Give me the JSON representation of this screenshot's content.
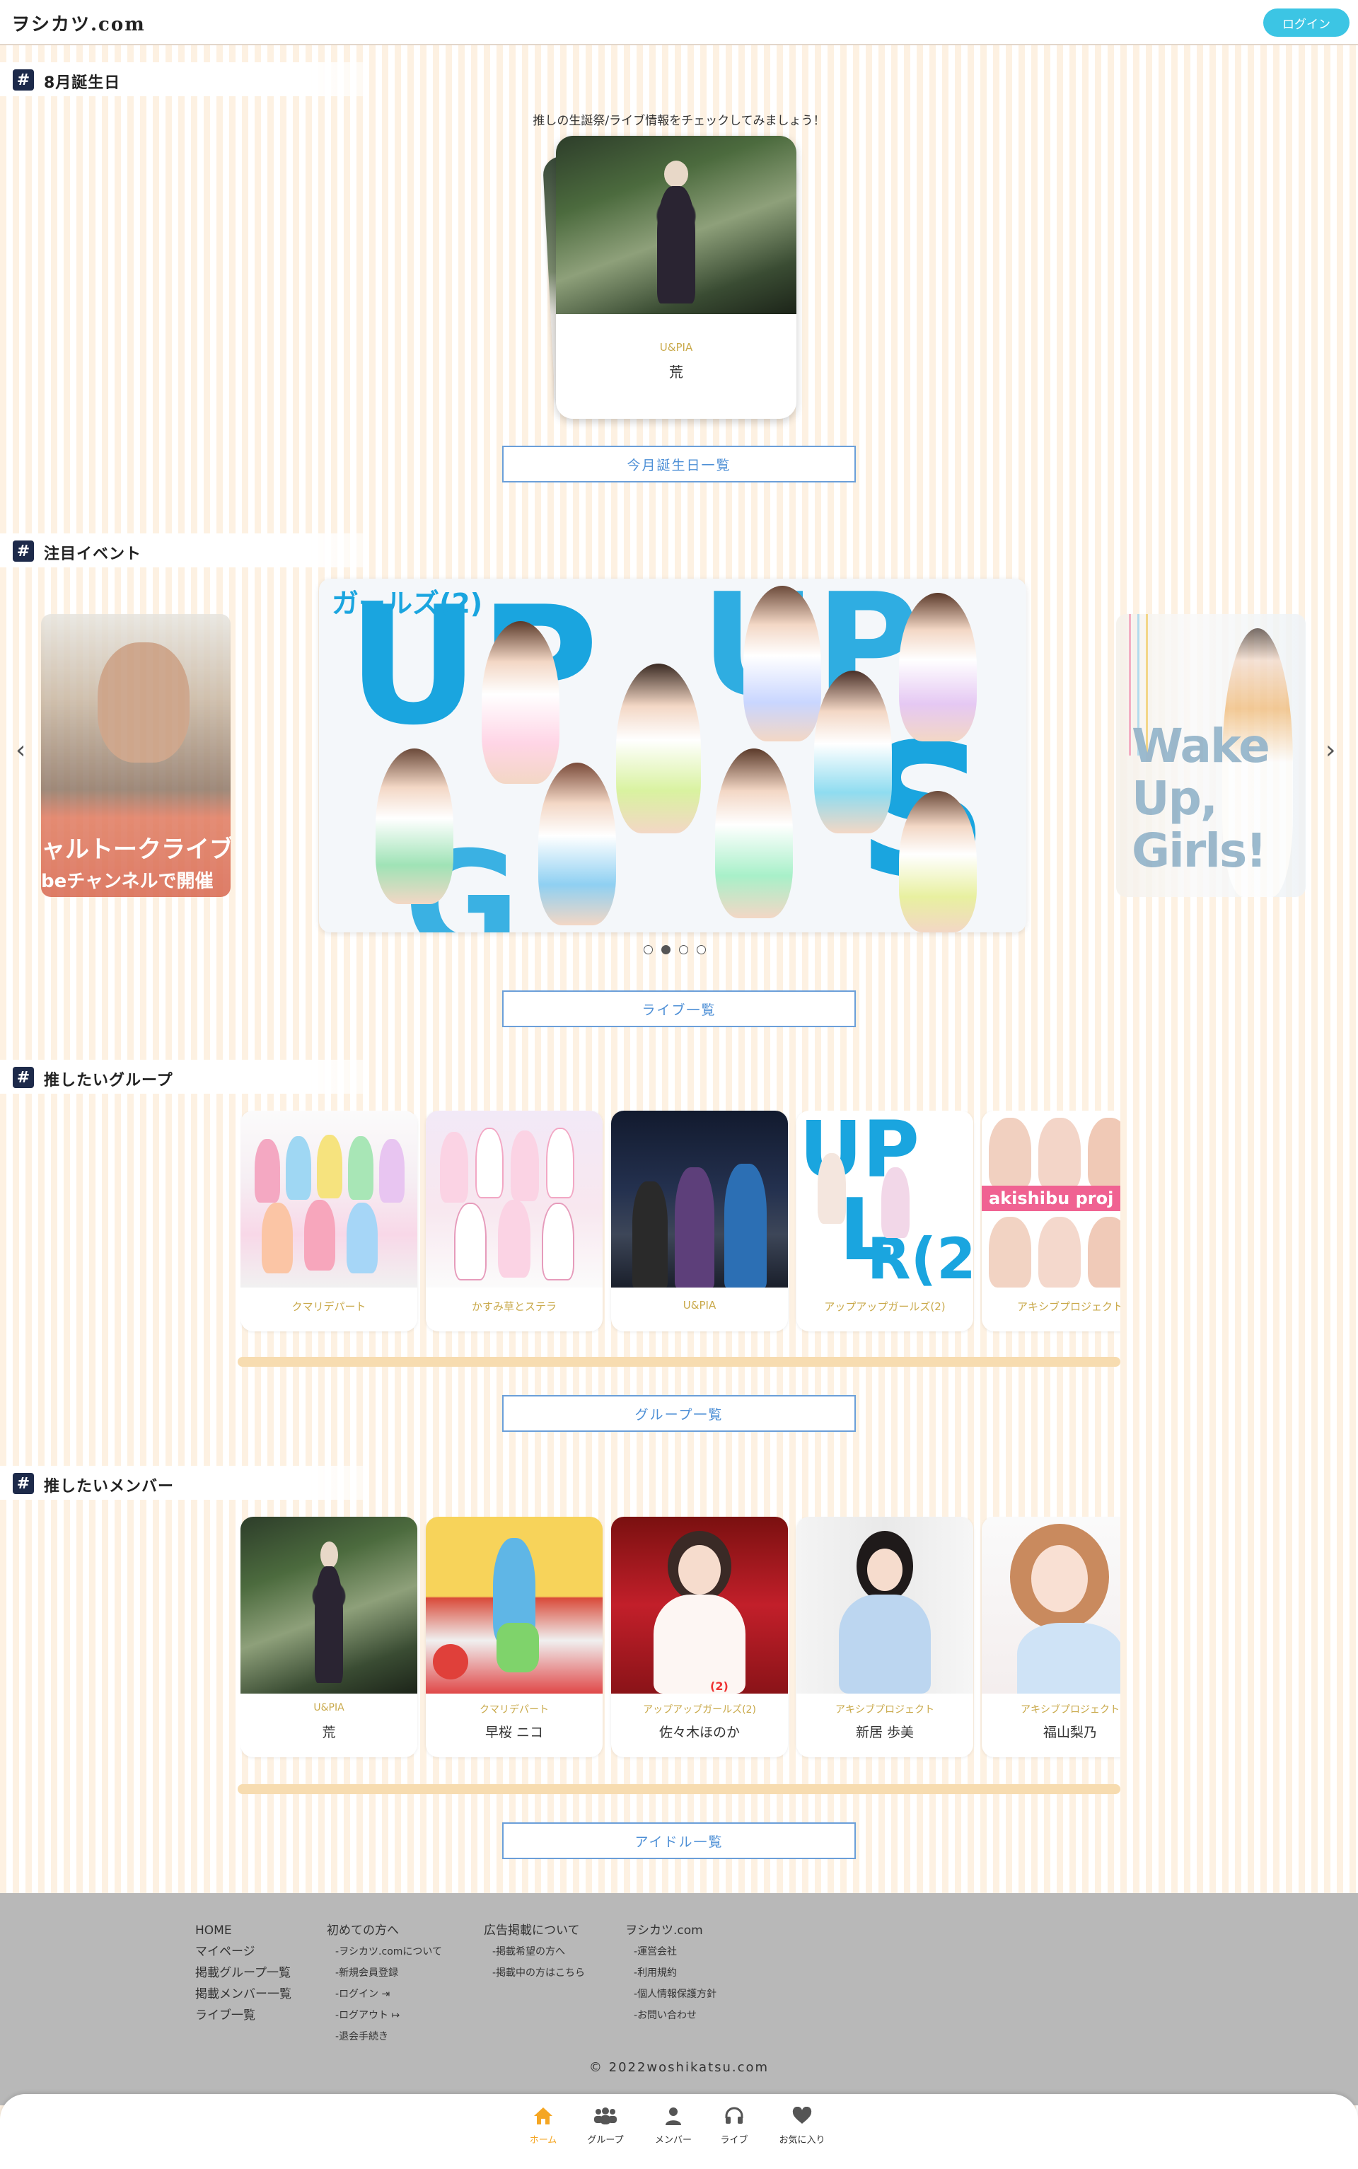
{
  "header": {
    "logo": "ヲシカツ.com",
    "login_label": "ログイン"
  },
  "colors": {
    "accent": "#3cc5e4",
    "gold": "#c9a94a",
    "link": "#4d8fd6",
    "stripe": "#fdf1e2",
    "scrollbar": "#f7dcb0",
    "footer": "#b8b8b8",
    "nav_active": "#f5a623"
  },
  "birthday": {
    "section_title": "8月誕生日",
    "subtitle": "推しの生誕祭/ライブ情報をチェックしてみましょう！",
    "card": {
      "group": "U&PIA",
      "name": "荒"
    },
    "button_label": "今月誕生日一覧"
  },
  "events": {
    "section_title": "注目イベント",
    "left_slide": {
      "line1": "ャルトークライブ",
      "line2": "beチャンネルで開催"
    },
    "main_slide": {
      "tag": "ガールズ(2)",
      "word1": "UP",
      "word2": "UP"
    },
    "right_slide": {
      "text1": "Wake",
      "text2": "Up,",
      "text3": "Girls!"
    },
    "dots": 4,
    "active_dot": 1,
    "button_label": "ライブ一覧"
  },
  "groups": {
    "section_title": "推したいグループ",
    "items": [
      {
        "name": "クマリデパート"
      },
      {
        "name": "かすみ草とステラ"
      },
      {
        "name": "U&PIA"
      },
      {
        "name": "アップアップガールズ(2)"
      },
      {
        "name": "アキシブプロジェクト"
      }
    ],
    "pink_banner": "akishibu proj",
    "button_label": "グループ一覧"
  },
  "members": {
    "section_title": "推したいメンバー",
    "items": [
      {
        "group": "U&PIA",
        "name": "荒"
      },
      {
        "group": "クマリデパート",
        "name": "早桜 ニコ"
      },
      {
        "group": "アップアップガールズ(2)",
        "name": "佐々木ほのか"
      },
      {
        "group": "アキシブプロジェクト",
        "name": "新居 歩美"
      },
      {
        "group": "アキシブプロジェクト",
        "name": "福山梨乃"
      }
    ],
    "badge": "(2)",
    "button_label": "アイドル一覧"
  },
  "footer": {
    "col1": [
      "HOME",
      "マイページ",
      "掲載グループ一覧",
      "掲載メンバー一覧",
      "ライブ一覧"
    ],
    "col2": {
      "head": "初めての方へ",
      "items": [
        "ヲシカツ.comについて",
        "新規会員登録",
        "ログイン",
        "ログアウト",
        "退会手続き"
      ]
    },
    "col3": {
      "head": "広告掲載について",
      "items": [
        "掲載希望の方へ",
        "掲載中の方はこちら"
      ]
    },
    "col4": {
      "head": "ヲシカツ.com",
      "items": [
        "運営会社",
        "利用規約",
        "個人情報保護方針",
        "お問い合わせ"
      ]
    },
    "copyright": "© 2022woshikatsu.com"
  },
  "bottom_nav": [
    {
      "label": "ホーム",
      "icon": "home-icon"
    },
    {
      "label": "グループ",
      "icon": "group-icon"
    },
    {
      "label": "メンバー",
      "icon": "user-icon"
    },
    {
      "label": "ライブ",
      "icon": "headphones-icon"
    },
    {
      "label": "お気に入り",
      "icon": "heart-icon"
    }
  ]
}
